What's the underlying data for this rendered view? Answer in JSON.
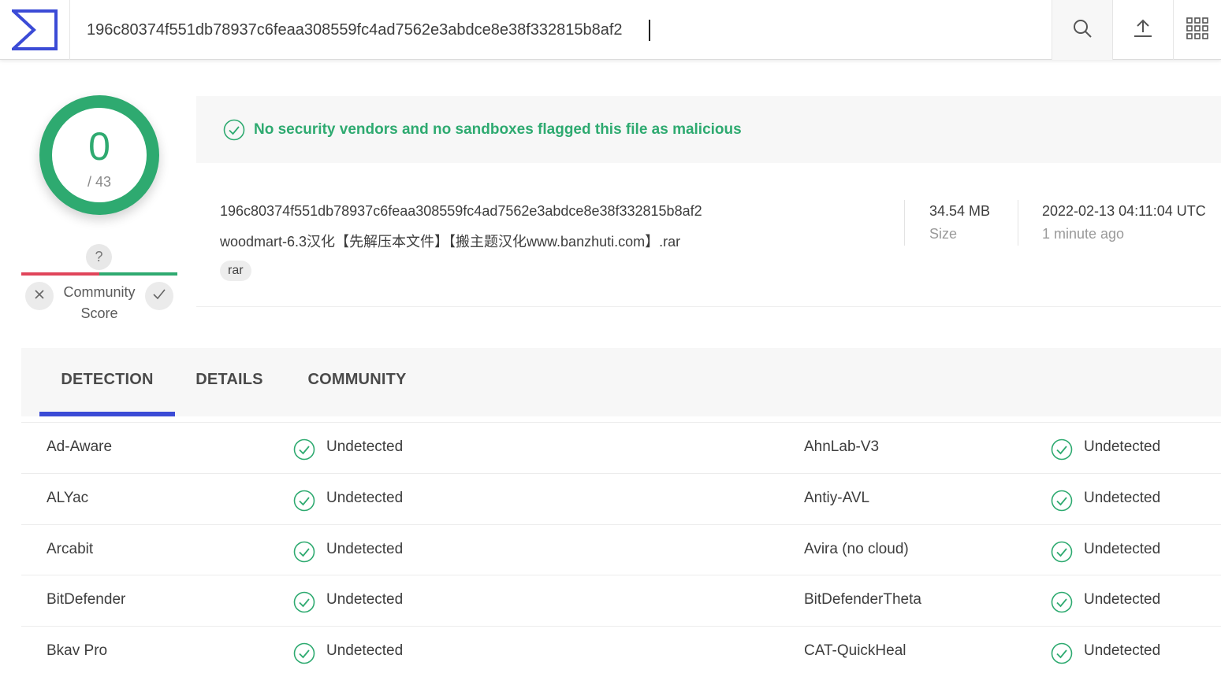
{
  "search": {
    "value": "196c80374f551db78937c6feaa308559fc4ad7562e3abdce8e38f332815b8af2"
  },
  "toolbar": {
    "icons": [
      "search-icon",
      "upload-icon",
      "apps-grid-icon"
    ]
  },
  "score": {
    "detected": "0",
    "total": "/ 43",
    "unknown_badge": "?",
    "community_label_line1": "Community",
    "community_label_line2": "Score"
  },
  "banner": {
    "text": "No security vendors and no sandboxes flagged this file as malicious"
  },
  "file": {
    "hash": "196c80374f551db78937c6feaa308559fc4ad7562e3abdce8e38f332815b8af2",
    "name": "woodmart-6.3汉化【先解压本文件】【搬主题汉化www.banzhuti.com】.rar",
    "tag": "rar",
    "size_value": "34.54 MB",
    "size_label": "Size",
    "date_value": "2022-02-13 04:11:04 UTC",
    "date_label": "1 minute ago"
  },
  "tabs": {
    "detection": "DETECTION",
    "details": "DETAILS",
    "community": "COMMUNITY",
    "active": "DETECTION"
  },
  "detections": [
    {
      "left_vendor": "Ad-Aware",
      "left_result": "Undetected",
      "right_vendor": "AhnLab-V3",
      "right_result": "Undetected"
    },
    {
      "left_vendor": "ALYac",
      "left_result": "Undetected",
      "right_vendor": "Antiy-AVL",
      "right_result": "Undetected"
    },
    {
      "left_vendor": "Arcabit",
      "left_result": "Undetected",
      "right_vendor": "Avira (no cloud)",
      "right_result": "Undetected"
    },
    {
      "left_vendor": "BitDefender",
      "left_result": "Undetected",
      "right_vendor": "BitDefenderTheta",
      "right_result": "Undetected"
    },
    {
      "left_vendor": "Bkav Pro",
      "left_result": "Undetected",
      "right_vendor": "CAT-QuickHeal",
      "right_result": "Undetected"
    }
  ],
  "colors": {
    "clean_green": "#2eaa70",
    "malicious_red": "#e0445a",
    "brand_blue": "#3b4bd6"
  }
}
